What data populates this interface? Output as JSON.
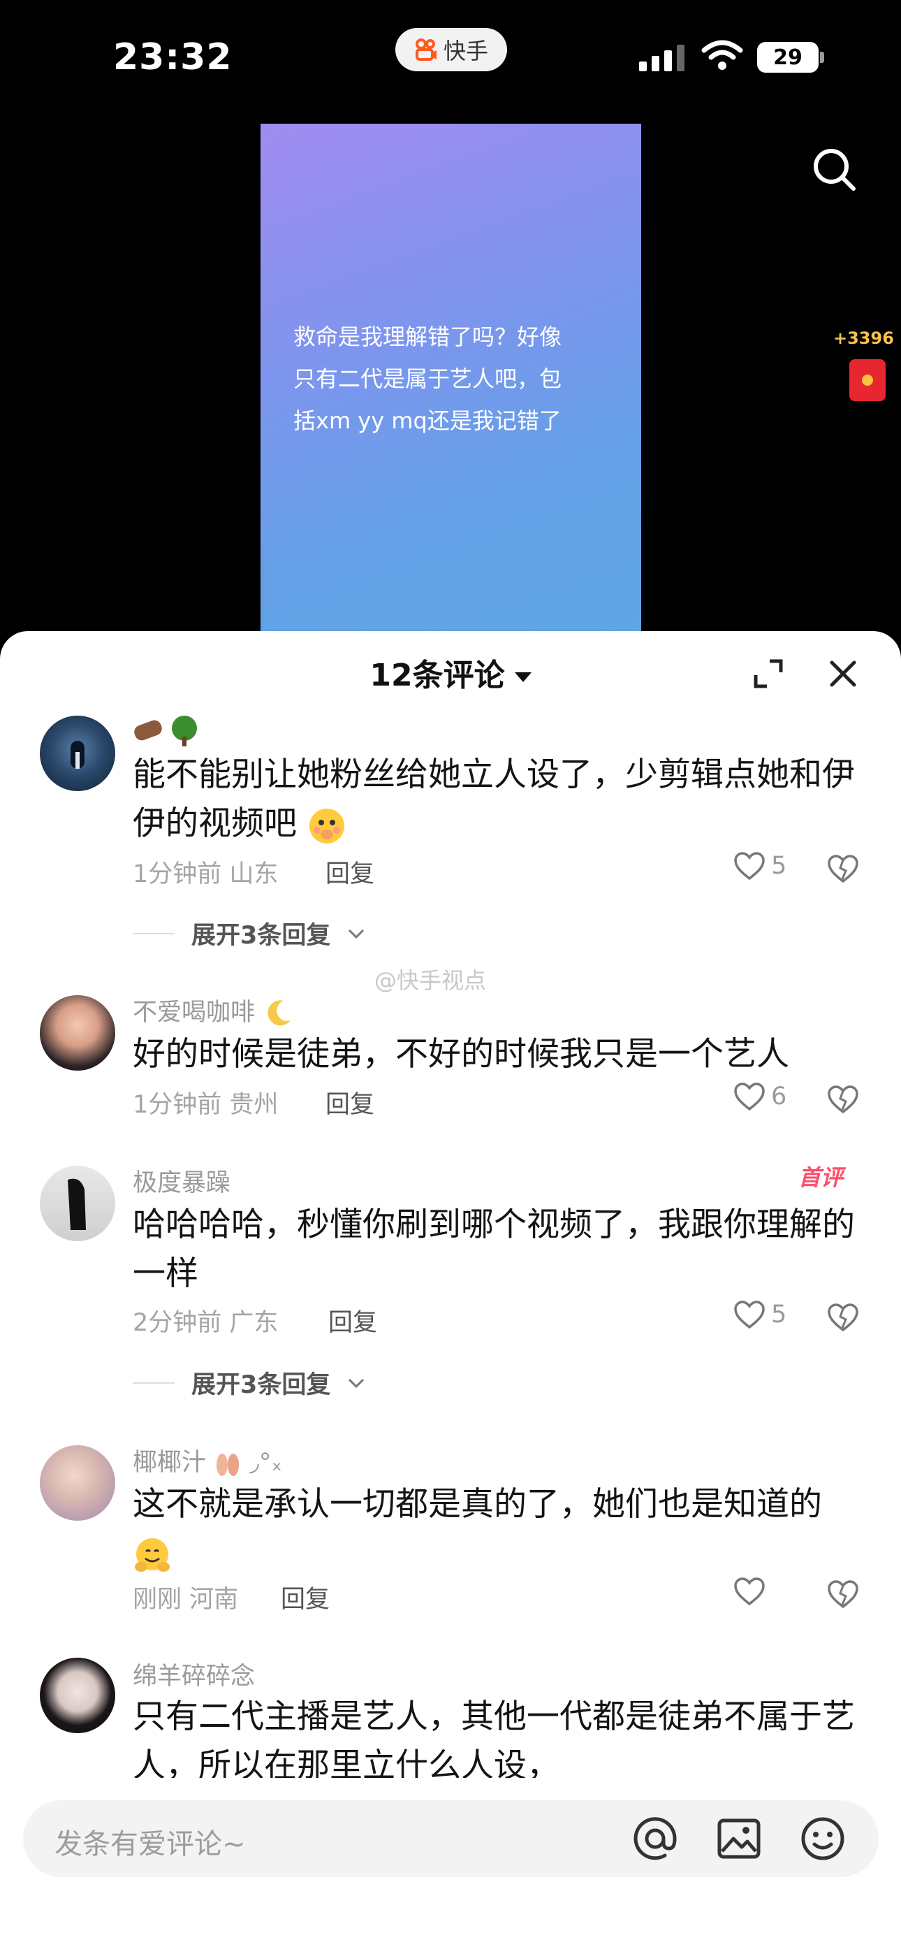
{
  "status_bar": {
    "time": "23:32",
    "app_name": "快手",
    "battery": "29"
  },
  "video": {
    "caption_lines": [
      "救命是我理解错了吗？好像",
      "只有二代是属于艺人吧，包",
      "括xm yy mq还是我记错了"
    ],
    "reward_count": "+3396"
  },
  "comments_sheet": {
    "title": "12条评论",
    "watermark": "@快手视点",
    "comments": [
      {
        "username": "",
        "text": "能不能别让她粉丝给她立人设了，少剪辑点她和伊伊的视频吧",
        "time": "1分钟前",
        "location": "山东",
        "reply_label": "回复",
        "likes": "5",
        "expand_label": "展开3条回复"
      },
      {
        "username": "不爱喝咖啡",
        "text": "好的时候是徒弟，不好的时候我只是一个艺人",
        "time": "1分钟前",
        "location": "贵州",
        "reply_label": "回复",
        "likes": "6"
      },
      {
        "username": "极度暴躁",
        "badge": "首评",
        "text": "哈哈哈哈，秒懂你刷到哪个视频了，我跟你理解的一样",
        "time": "2分钟前",
        "location": "广东",
        "reply_label": "回复",
        "likes": "5",
        "expand_label": "展开3条回复"
      },
      {
        "username": "椰椰汁",
        "username_suffix": "◞°ₓ",
        "text": "这不就是承认一切都是真的了，她们也是知道的",
        "time": "刚刚",
        "location": "河南",
        "reply_label": "回复",
        "likes": ""
      },
      {
        "username": "绵羊碎碎念",
        "text": "只有二代主播是艺人，其他一代都是徒弟不属于艺人，所以在那里立什么人设，"
      }
    ]
  },
  "input": {
    "placeholder": "发条有爱评论~"
  },
  "colors": {
    "accent_red": "#e8262f",
    "badge_pink": "#ff4d6a",
    "video_top": "#a18cf0",
    "video_bottom": "#5ea6e4"
  }
}
